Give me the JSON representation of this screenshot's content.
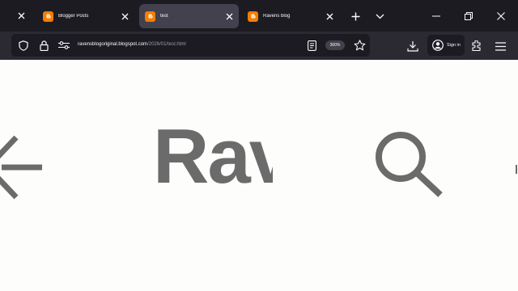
{
  "tabs": [
    {
      "title": "Blogger Posts",
      "active": false
    },
    {
      "title": "test",
      "active": true
    },
    {
      "title": "Ravens blog",
      "active": false
    }
  ],
  "address": {
    "domain": "ravensblogoriginal.blogspot.com",
    "path": "/2026/01/test.html"
  },
  "zoom": "300%",
  "account": {
    "label": "Sign in"
  },
  "content": {
    "word": "Rav"
  },
  "colors": {
    "brand": "#f57d00",
    "titlebar": "#1c1b22",
    "toolbar": "#2b2a33",
    "glyph": "#6b6b6b"
  },
  "icons": [
    "close-icon",
    "plus-icon",
    "chevron-down-icon",
    "minimize-icon",
    "restore-icon",
    "shield-icon",
    "lock-icon",
    "permissions-icon",
    "reader-view-icon",
    "star-icon",
    "download-icon",
    "account-icon",
    "extensions-icon",
    "menu-icon",
    "arrow-left-icon",
    "search-icon"
  ]
}
